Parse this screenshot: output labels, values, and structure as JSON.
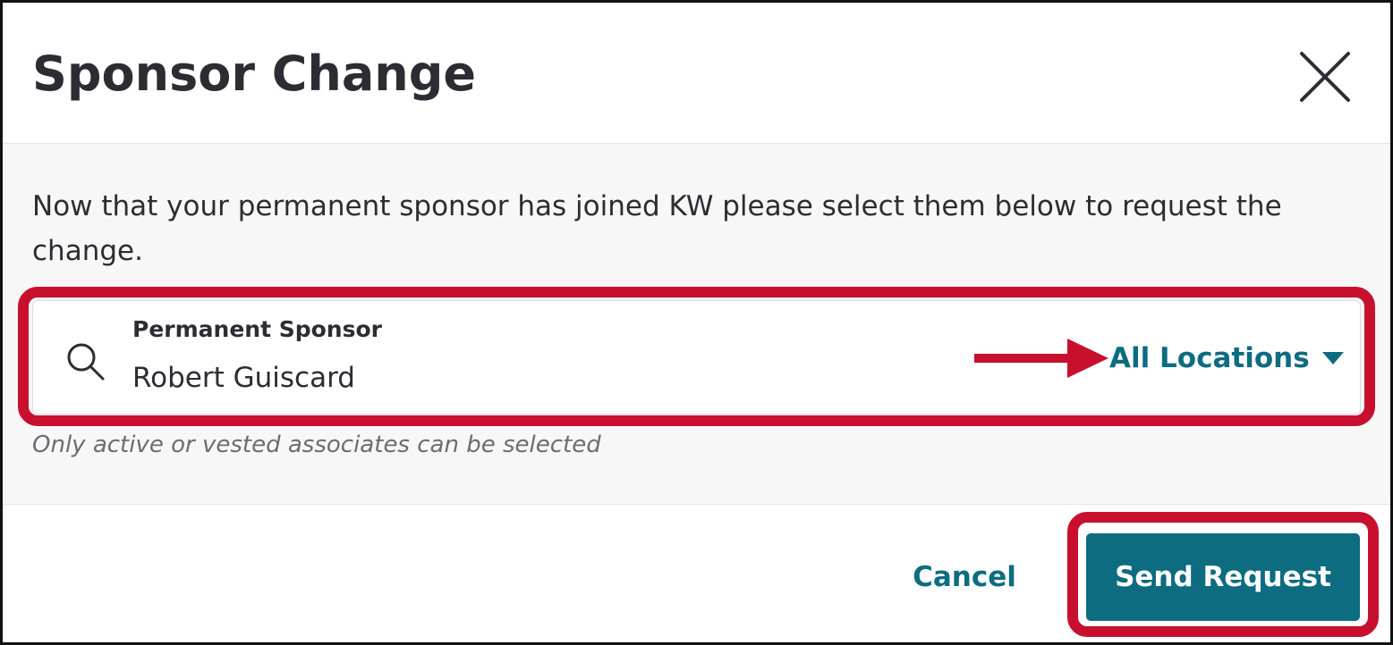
{
  "dialog": {
    "title": "Sponsor Change",
    "description": "Now that your permanent sponsor has joined KW please select them below to request the change.",
    "sponsor_field": {
      "label": "Permanent Sponsor",
      "value": "Robert Guiscard",
      "location_filter": "All Locations"
    },
    "hint": "Only active or vested associates can be selected",
    "cancel_label": "Cancel",
    "send_label": "Send Request"
  },
  "icons": {
    "close": "close-icon",
    "search": "search-icon",
    "dropdown": "caret-down-icon",
    "annotation_arrow": "arrow-right-icon"
  },
  "colors": {
    "accent": "#0d6c80",
    "annotation": "#c8102e",
    "title_text": "#2b2d33",
    "body_bg": "#f7f7f7",
    "hint_text": "#6a6d73"
  }
}
